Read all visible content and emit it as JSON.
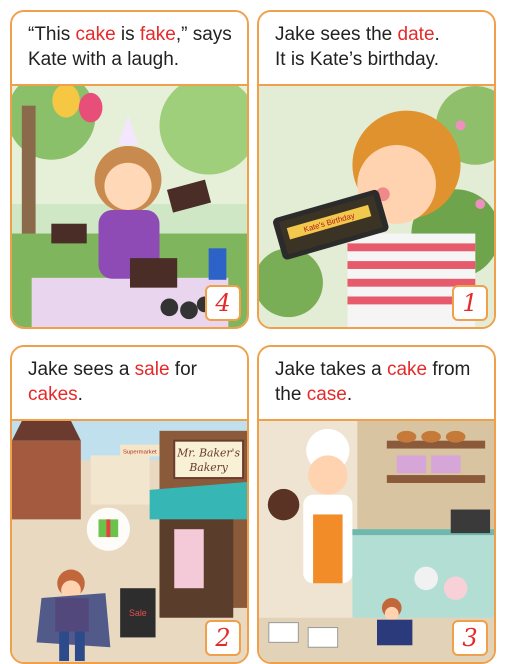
{
  "panels": [
    {
      "number": "4",
      "caption": [
        {
          "t": "“This ",
          "hl": false
        },
        {
          "t": "cake",
          "hl": true
        },
        {
          "t": " is ",
          "hl": false
        },
        {
          "t": "fake",
          "hl": true
        },
        {
          "t": ",” says",
          "hl": false
        },
        {
          "t": "\n Kate with a laugh.",
          "hl": false
        }
      ]
    },
    {
      "number": "1",
      "caption": [
        {
          "t": "Jake sees the ",
          "hl": false
        },
        {
          "t": "date",
          "hl": true
        },
        {
          "t": ".",
          "hl": false
        },
        {
          "t": "\nIt is Kate’s birthday.",
          "hl": false
        }
      ],
      "phone_text": "Kate's Birthday"
    },
    {
      "number": "2",
      "caption": [
        {
          "t": "Jake sees a ",
          "hl": false
        },
        {
          "t": "sale",
          "hl": true
        },
        {
          "t": " for",
          "hl": false
        },
        {
          "t": "\n",
          "hl": false
        },
        {
          "t": "cakes",
          "hl": true
        },
        {
          "t": ".",
          "hl": false
        }
      ],
      "shop_sign": [
        "Mr. Baker's",
        "Bakery"
      ],
      "street_sign": "Supermarket",
      "board_text": "Sale"
    },
    {
      "number": "3",
      "caption": [
        {
          "t": "Jake takes a ",
          "hl": false
        },
        {
          "t": "cake",
          "hl": true
        },
        {
          "t": " from",
          "hl": false
        },
        {
          "t": "\nthe ",
          "hl": false
        },
        {
          "t": "case",
          "hl": true
        },
        {
          "t": ".",
          "hl": false
        }
      ]
    }
  ],
  "colors": {
    "border": "#f0a04b",
    "highlight": "#e52a2a"
  }
}
